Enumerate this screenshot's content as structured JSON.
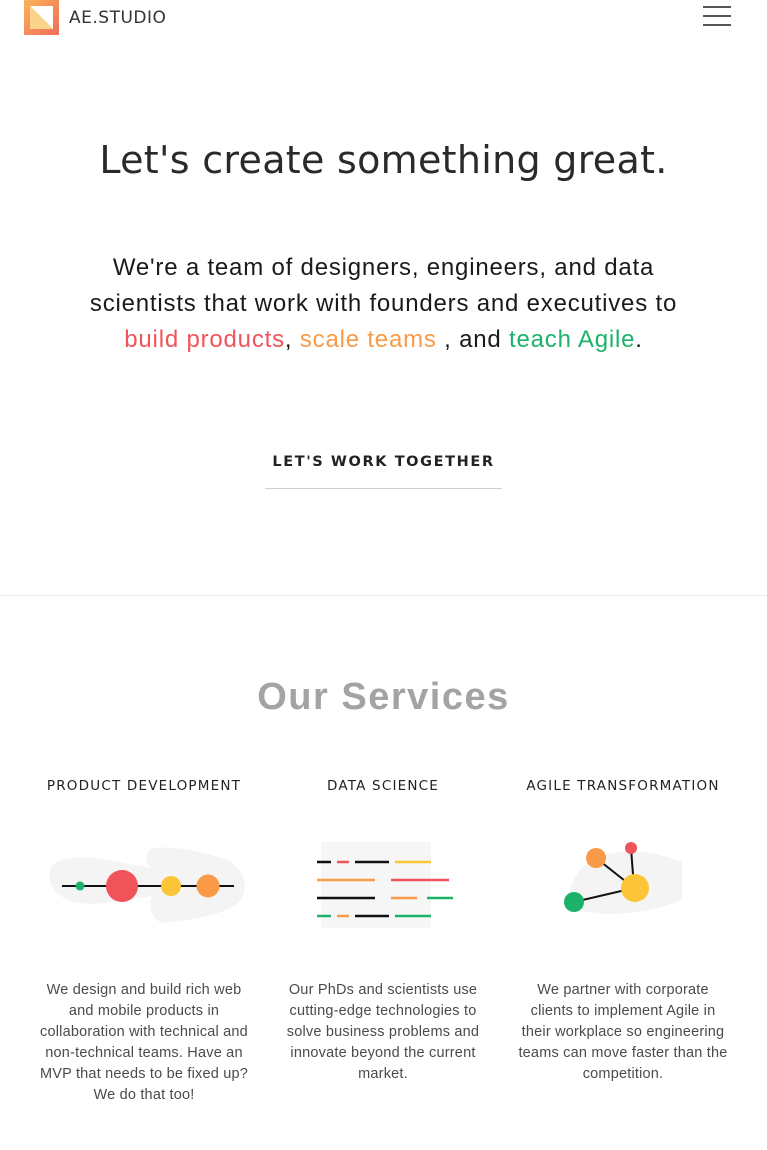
{
  "header": {
    "brand": "AE.STUDIO",
    "logo_icon": "ae-studio-logo-icon",
    "menu_icon": "hamburger-menu-icon"
  },
  "hero": {
    "title": "Let's create something great.",
    "intro": "We're a team of designers, engineers, and data scientists that work with founders and executives to",
    "highlight_1": "build products",
    "sep_1": ",",
    "highlight_2": "scale teams",
    "sep_2": ", and",
    "highlight_3": "teach Agile",
    "end": ".",
    "cta_label": "LET'S WORK TOGETHER"
  },
  "services": {
    "title": "Our Services",
    "items": [
      {
        "heading": "PRODUCT DEVELOPMENT",
        "icon": "product-development-illustration-icon",
        "description": "We design and build rich web and mobile products in collaboration with technical and non-technical teams. Have an MVP that needs to be fixed up? We do that too!"
      },
      {
        "heading": "DATA SCIENCE",
        "icon": "data-science-illustration-icon",
        "description": "Our PhDs and scientists use cutting-edge technologies to solve business problems and innovate beyond the current market."
      },
      {
        "heading": "AGILE TRANSFORMATION",
        "icon": "agile-network-illustration-icon",
        "description": "We partner with corporate clients to implement Agile in their workplace so engineering teams can move faster than the competition."
      }
    ]
  },
  "colors": {
    "red": "#f0535a",
    "orange": "#f89a48",
    "yellow": "#fcc437",
    "green": "#1db26a",
    "heading_gray": "#a3a3a3"
  }
}
